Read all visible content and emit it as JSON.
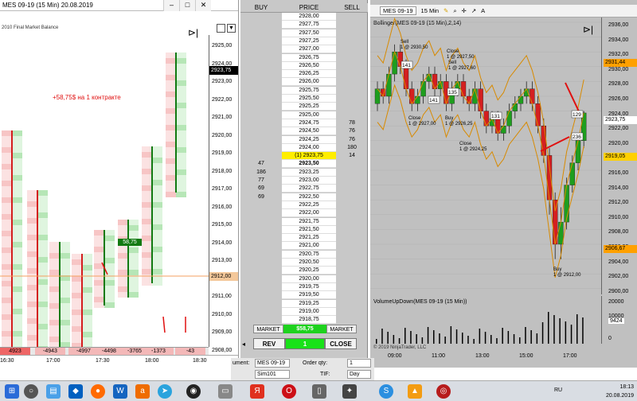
{
  "left_window": {
    "title": "MES 09-19 (15 Min)   20.08.2019",
    "subtitle": "2010 Final Market Balance",
    "profit_note": "+58,75$ на 1 контракте",
    "price_ticks": [
      "2925,00",
      "2924,00",
      "2923,00",
      "2922,00",
      "2921,00",
      "2920,00",
      "2919,00",
      "2918,00",
      "2917,00",
      "2916,00",
      "2915,00",
      "2914,00",
      "2913,00",
      "2912,00",
      "2911,00",
      "2910,00",
      "2909,00",
      "2908,00"
    ],
    "last_price_tag": "2923,75",
    "position_tag": "2912,00",
    "entry_label": "58,75",
    "delta_row": [
      "4923",
      "-4943",
      "-4997",
      "-4498",
      "-3765",
      "-1373",
      "-43"
    ],
    "time_ticks": [
      "16:30",
      "17:00",
      "17:30",
      "18:00",
      "18:30"
    ],
    "win_buttons": [
      "–",
      "□",
      "✕"
    ]
  },
  "dom": {
    "headers": [
      "BUY",
      "PRICE",
      "SELL"
    ],
    "rows": [
      {
        "buy": "",
        "price": "2928,00",
        "sell": ""
      },
      {
        "buy": "",
        "price": "2927,75",
        "sell": ""
      },
      {
        "buy": "",
        "price": "2927,50",
        "sell": ""
      },
      {
        "buy": "",
        "price": "2927,25",
        "sell": ""
      },
      {
        "buy": "",
        "price": "2927,00",
        "sell": ""
      },
      {
        "buy": "",
        "price": "2926,75",
        "sell": ""
      },
      {
        "buy": "",
        "price": "2926,50",
        "sell": ""
      },
      {
        "buy": "",
        "price": "2926,25",
        "sell": ""
      },
      {
        "buy": "",
        "price": "2926,00",
        "sell": ""
      },
      {
        "buy": "",
        "price": "2925,75",
        "sell": ""
      },
      {
        "buy": "",
        "price": "2925,50",
        "sell": ""
      },
      {
        "buy": "",
        "price": "2925,25",
        "sell": ""
      },
      {
        "buy": "",
        "price": "2925,00",
        "sell": ""
      },
      {
        "buy": "",
        "price": "2924,75",
        "sell": "78"
      },
      {
        "buy": "",
        "price": "2924,50",
        "sell": "76"
      },
      {
        "buy": "",
        "price": "2924,25",
        "sell": "76"
      },
      {
        "buy": "",
        "price": "2924,00",
        "sell": "180"
      },
      {
        "buy": "",
        "price": "(1) 2923,75",
        "sell": "14",
        "highlight": "yellow"
      },
      {
        "buy": "47",
        "price": "2923,50",
        "sell": "",
        "bold": true
      },
      {
        "buy": "186",
        "price": "2923,25",
        "sell": ""
      },
      {
        "buy": "77",
        "price": "2923,00",
        "sell": ""
      },
      {
        "buy": "69",
        "price": "2922,75",
        "sell": ""
      },
      {
        "buy": "69",
        "price": "2922,50",
        "sell": ""
      },
      {
        "buy": "",
        "price": "2922,25",
        "sell": ""
      },
      {
        "buy": "",
        "price": "2922,00",
        "sell": ""
      },
      {
        "buy": "",
        "price": "2921,75",
        "sell": ""
      },
      {
        "buy": "",
        "price": "2921,50",
        "sell": ""
      },
      {
        "buy": "",
        "price": "2921,25",
        "sell": ""
      },
      {
        "buy": "",
        "price": "2921,00",
        "sell": ""
      },
      {
        "buy": "",
        "price": "2920,75",
        "sell": ""
      },
      {
        "buy": "",
        "price": "2920,50",
        "sell": ""
      },
      {
        "buy": "",
        "price": "2920,25",
        "sell": ""
      },
      {
        "buy": "",
        "price": "2920,00",
        "sell": ""
      },
      {
        "buy": "",
        "price": "2919,75",
        "sell": ""
      },
      {
        "buy": "",
        "price": "2919,50",
        "sell": ""
      },
      {
        "buy": "",
        "price": "2919,25",
        "sell": ""
      },
      {
        "buy": "",
        "price": "2919,00",
        "sell": ""
      },
      {
        "buy": "",
        "price": "2918,75",
        "sell": ""
      }
    ],
    "market_left": "MARKET",
    "pnl": "$58,75",
    "market_right": "MARKET",
    "rev_label": "REV",
    "qty_value": "1",
    "close_label": "CLOSE"
  },
  "right_window": {
    "instrument": "MES 09-19",
    "interval": "15 Min",
    "indicator_label": "Bollinger(MES 09-19 (15 Min),2,14)",
    "price_ticks": [
      "2936,00",
      "2934,00",
      "2932,00",
      "2930,00",
      "2928,00",
      "2926,00",
      "2924,00",
      "2922,00",
      "2920,00",
      "2918,00",
      "2916,00",
      "2914,00",
      "2912,00",
      "2910,00",
      "2908,00",
      "2906,00",
      "2904,00",
      "2902,00",
      "2900,00"
    ],
    "upper_band_tag": "2931,44",
    "last_price_tag": "2923,75",
    "middle_band_tag": "2919,05",
    "lower_band_tag": "2906,67",
    "trade_labels": [
      {
        "text": "Sell\n1 @ 2930,50"
      },
      {
        "text": "Close\n1 @ 2927,50"
      },
      {
        "text": "Sell\n1 @ 2927,60"
      },
      {
        "text": "Close\n1 @ 2927,00"
      },
      {
        "text": "Buy\n1 @ 2926,25"
      },
      {
        "text": "Close\n1 @ 2924,25"
      },
      {
        "text": "Buy\n1 @ 2912,00"
      }
    ],
    "bar_counts": [
      "141",
      "141",
      "135",
      "131",
      "129",
      "236"
    ],
    "volume_label": "VolumeUpDown(MES 09-19 (15 Min))",
    "volume_ticks": [
      "20000",
      "10000",
      "9424",
      "0"
    ],
    "time_ticks": [
      "09:00",
      "11:00",
      "13:00",
      "15:00",
      "17:00"
    ],
    "copyright": "© 2019 NinjaTrader, LLC"
  },
  "order_entry": {
    "instrument_label": "ument:",
    "instrument_value": "MES 09-19",
    "account_value": "Sim101",
    "qty_label": "Order qty:",
    "qty_value": "1",
    "tif_label": "TIF:",
    "tif_value": "Day"
  },
  "taskbar": {
    "lang": "RU",
    "time": "18:13",
    "date": "20.08.2019"
  },
  "colors": {
    "bull": "#1f7a1f",
    "bear": "#d41f1f",
    "ask_bg": "#d9f2d9",
    "bid_bg": "#f8d6d6",
    "band": "#d88a00",
    "tag_upper": "#ffa000",
    "tag_mid": "#ffd000",
    "tag_last": "#ffffff"
  }
}
